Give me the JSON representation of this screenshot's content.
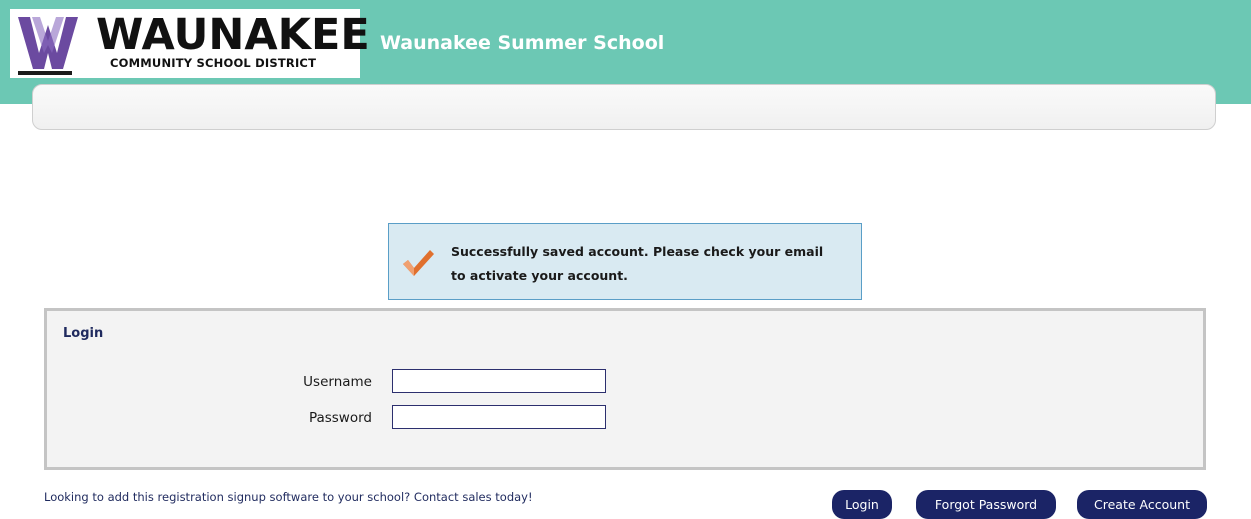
{
  "header": {
    "logo_word": "WAUNAKEE",
    "logo_subtitle": "COMMUNITY SCHOOL DISTRICT",
    "site_title": "Waunakee Summer School",
    "icon": "waunakee-w-logo"
  },
  "alert": {
    "icon": "checkmark-icon",
    "message": "Successfully saved account. Please check your email to activate your account."
  },
  "login": {
    "title": "Login",
    "username_label": "Username",
    "username_value": "",
    "password_label": "Password",
    "password_value": ""
  },
  "footer": {
    "promo_text": "Looking to add this registration signup software to your school? Contact sales today!"
  },
  "buttons": {
    "login": "Login",
    "forgot_password": "Forgot Password",
    "create_account": "Create Account"
  },
  "colors": {
    "header_bg": "#6cc8b4",
    "button_bg": "#1b2466",
    "alert_bg": "#d9eaf2",
    "alert_border": "#5a9ec7",
    "logo_purple": "#6b4aa0",
    "check_orange": "#e0702e"
  }
}
